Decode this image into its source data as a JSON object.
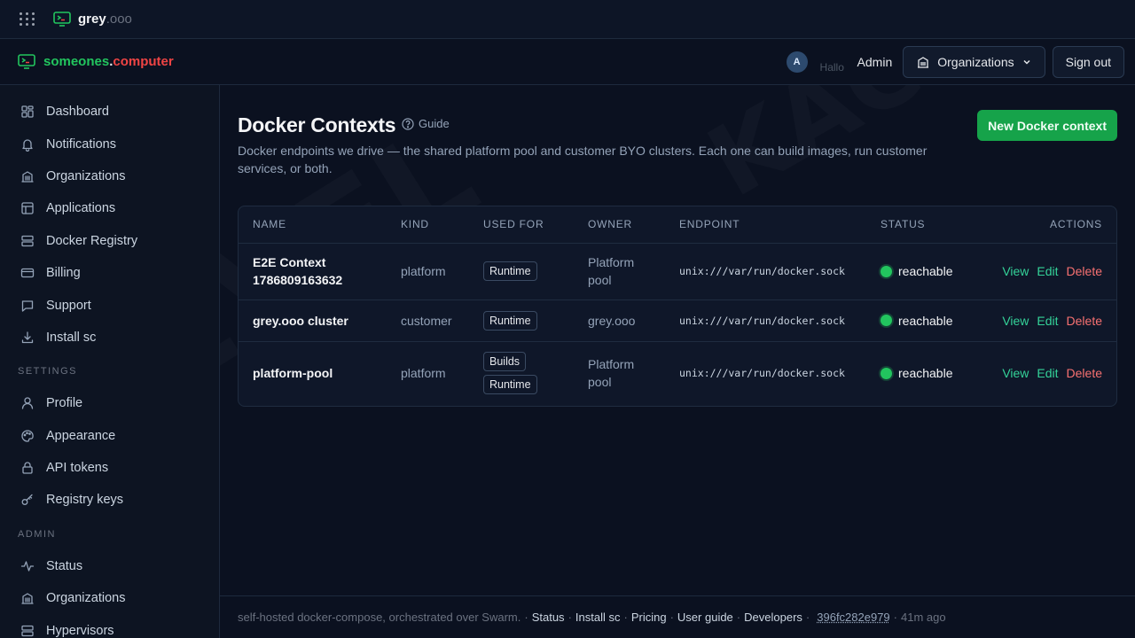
{
  "topbar": {
    "brand_name": "grey",
    "brand_tld": ".ooo"
  },
  "header": {
    "brand_part1": "someones",
    "brand_part2": ".",
    "brand_part3": "computer",
    "avatar_initial": "A",
    "hallo": "Hallo",
    "admin_name": "Admin",
    "organizations_label": "Organizations",
    "sign_out_label": "Sign out"
  },
  "sidebar": {
    "main_items": [
      {
        "label": "Dashboard",
        "icon": "dashboard-icon"
      },
      {
        "label": "Notifications",
        "icon": "bell-icon"
      },
      {
        "label": "Organizations",
        "icon": "building-icon"
      },
      {
        "label": "Applications",
        "icon": "layout-icon"
      },
      {
        "label": "Docker Registry",
        "icon": "server-icon"
      },
      {
        "label": "Billing",
        "icon": "credit-card-icon"
      },
      {
        "label": "Support",
        "icon": "chat-icon"
      },
      {
        "label": "Install sc",
        "icon": "download-icon"
      }
    ],
    "settings_label": "SETTINGS",
    "settings_items": [
      {
        "label": "Profile",
        "icon": "user-icon"
      },
      {
        "label": "Appearance",
        "icon": "palette-icon"
      },
      {
        "label": "API tokens",
        "icon": "lock-icon"
      },
      {
        "label": "Registry keys",
        "icon": "key-icon"
      }
    ],
    "admin_label": "ADMIN",
    "admin_items": [
      {
        "label": "Status",
        "icon": "activity-icon"
      },
      {
        "label": "Organizations",
        "icon": "building-icon"
      },
      {
        "label": "Hypervisors",
        "icon": "server-icon"
      }
    ]
  },
  "page": {
    "title": "Docker Contexts",
    "guide_label": "Guide",
    "description": "Docker endpoints we drive — the shared platform pool and customer BYO clusters. Each one can build images, run customer services, or both.",
    "new_button": "New Docker context"
  },
  "table": {
    "columns": [
      "NAME",
      "KIND",
      "USED FOR",
      "OWNER",
      "ENDPOINT",
      "STATUS",
      "ACTIONS"
    ],
    "rows": [
      {
        "name": "E2E Context 1786809163632",
        "kind": "platform",
        "used_for": [
          "Runtime"
        ],
        "owner": "Platform pool",
        "endpoint": "unix:///var/run/docker.sock",
        "status": "reachable"
      },
      {
        "name": "grey.ooo cluster",
        "kind": "customer",
        "used_for": [
          "Runtime"
        ],
        "owner": "grey.ooo",
        "endpoint": "unix:///var/run/docker.sock",
        "status": "reachable"
      },
      {
        "name": "platform-pool",
        "kind": "platform",
        "used_for": [
          "Builds",
          "Runtime"
        ],
        "owner": "Platform pool",
        "endpoint": "unix:///var/run/docker.sock",
        "status": "reachable"
      }
    ],
    "actions": {
      "view": "View",
      "edit": "Edit",
      "delete": "Delete"
    }
  },
  "footer": {
    "text": "self-hosted docker-compose, orchestrated over Swarm.",
    "links": [
      "Status",
      "Install sc",
      "Pricing",
      "User guide",
      "Developers"
    ],
    "commit": "396fc282e979",
    "age": "41m ago"
  },
  "colors": {
    "accent": "#16a34a",
    "status_ok": "#22c55e",
    "danger": "#f87171",
    "brand_red": "#ef4444"
  }
}
